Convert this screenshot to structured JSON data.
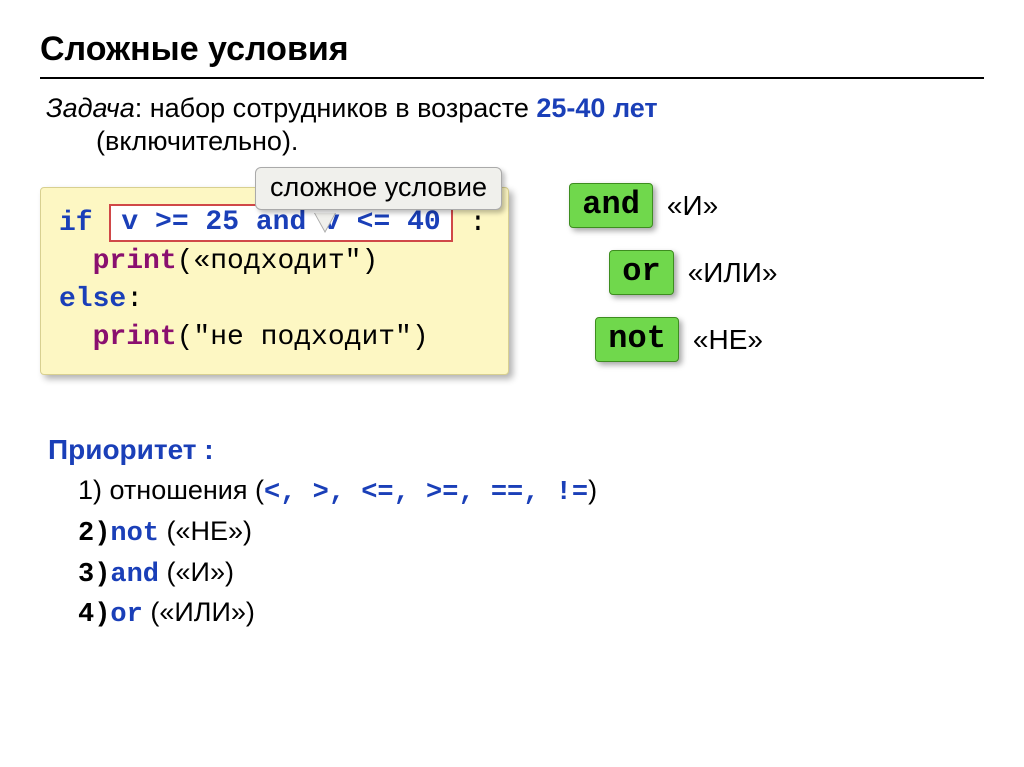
{
  "title": "Сложные условия",
  "task": {
    "label": "Задача",
    "sep": ": ",
    "text": "набор сотрудников в возрасте ",
    "range": "25-40 лет",
    "sub": "(включительно)."
  },
  "callout": "сложное условие",
  "code": {
    "if_kw": "if",
    "colon": " :",
    "cond": "v >= 25 and v <= 40",
    "print1_fn": "print",
    "print1_arg": "(«подходит\")",
    "else_kw": "else",
    "else_colon": ":",
    "print2_fn": "print",
    "print2_arg": "(\"не подходит\")",
    "indent": "  "
  },
  "ops": [
    {
      "box": "and",
      "label": "«И»"
    },
    {
      "box": "or",
      "label": "«ИЛИ»"
    },
    {
      "box": "not",
      "label": "«НЕ»"
    }
  ],
  "priority": {
    "title": "Приоритет :",
    "line1_prefix": "1) отношения (",
    "line1_ops": "<, >, <=, >=, ==, !=",
    "line1_suffix": ")",
    "line2_num": "2)",
    "line2_kw": "not",
    "line2_label": "(«НЕ»)",
    "line3_num": "3)",
    "line3_kw": "and",
    "line3_label": "(«И»)",
    "line4_num": "4)",
    "line4_kw": "or",
    "line4_label": "(«ИЛИ»)"
  }
}
